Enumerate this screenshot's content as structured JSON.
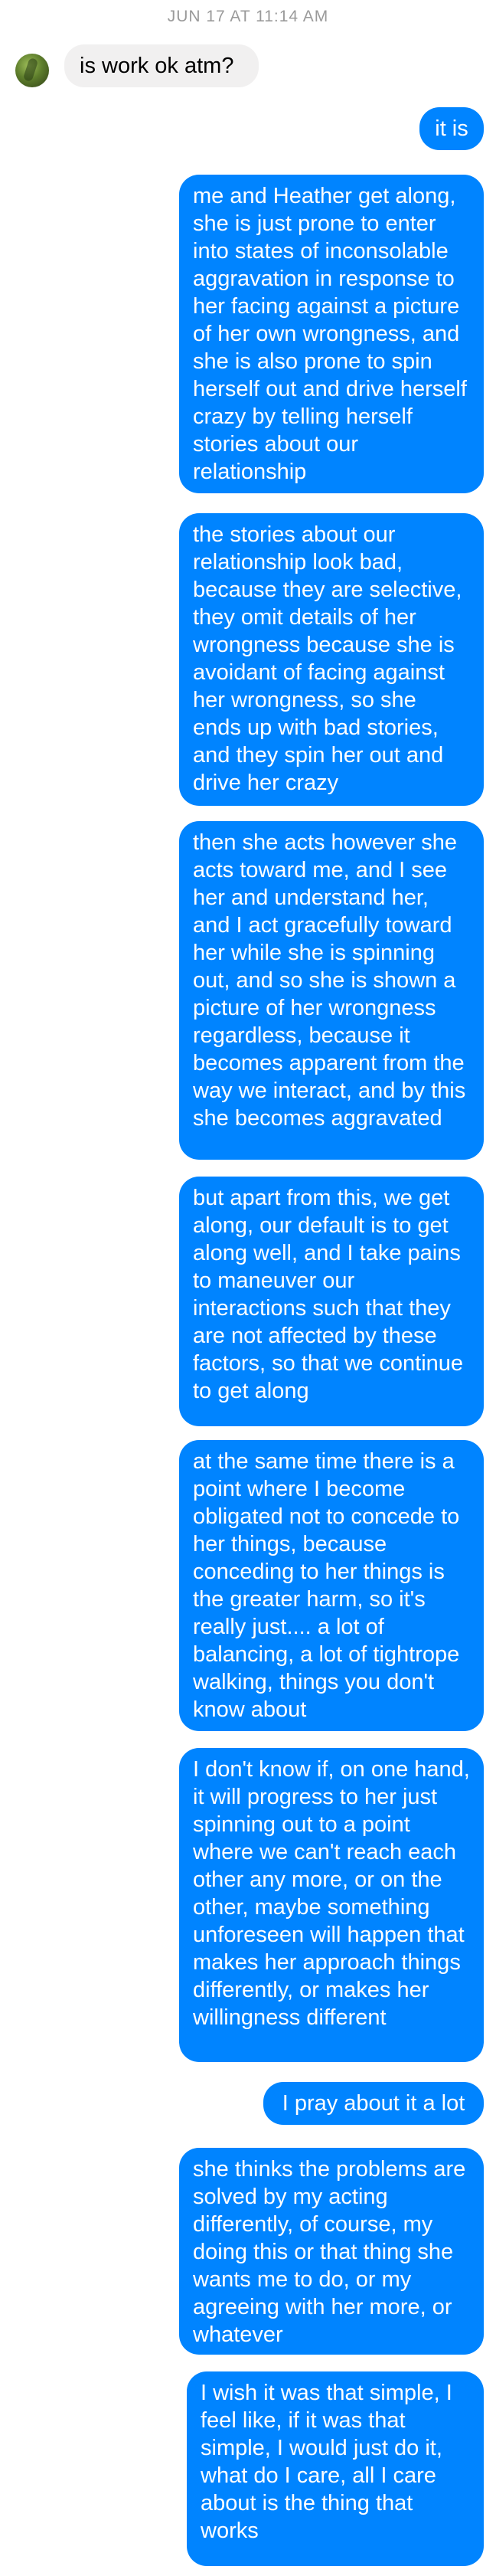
{
  "conversation": {
    "timestamp": "JUN 17 AT 11:14 AM",
    "messages": [
      {
        "direction": "incoming",
        "text": "is work ok atm?"
      },
      {
        "direction": "outgoing",
        "text": "it is"
      },
      {
        "direction": "outgoing",
        "text": "me and Heather get along, she is just prone to enter into states of inconsolable aggravation in response to her facing against a picture of her own wrongness, and she is also prone to spin herself out and drive herself crazy by telling herself stories about our relationship"
      },
      {
        "direction": "outgoing",
        "text": "the stories about our relationship look bad, because they are selective, they omit details of her wrongness because she is avoidant of facing against her wrongness, so she ends up with bad stories, and they spin her out and drive her crazy"
      },
      {
        "direction": "outgoing",
        "text": "then she acts however she acts toward me, and I see her and understand her, and I act gracefully toward her while she is spinning out, and so she is shown a picture of her wrongness regardless, because it becomes apparent from the way we interact, and by this she becomes aggravated"
      },
      {
        "direction": "outgoing",
        "text": "but apart from this, we get along, our default is to get along well, and I take pains to maneuver our interactions such that they are not affected by these factors, so that we continue to get along"
      },
      {
        "direction": "outgoing",
        "text": "at the same time there is a point where I become obligated not to concede to her things, because conceding to her things is the greater harm, so it's really just.... a lot of balancing, a lot of tightrope walking, things you don't know about"
      },
      {
        "direction": "outgoing",
        "text": "I don't know if, on one hand, it will progress to her just spinning out to a point where we can't reach each other any more, or on the other, maybe something unforeseen will happen that makes her approach things differently, or makes her willingness different"
      },
      {
        "direction": "outgoing",
        "text": "I pray about it a lot"
      },
      {
        "direction": "outgoing",
        "text": "she thinks the problems are solved by my acting differently, of course, my doing this or that thing she wants me to do, or my agreeing with her more, or whatever"
      },
      {
        "direction": "outgoing",
        "text": "I wish it was that simple, I feel like, if it was that simple, I would just do it, what do I care, all I care about is the thing that works"
      }
    ]
  },
  "colors": {
    "outgoing_bubble": "#0084ff",
    "incoming_bubble": "#f1f0f0",
    "timestamp_text": "#9a9a9a"
  }
}
